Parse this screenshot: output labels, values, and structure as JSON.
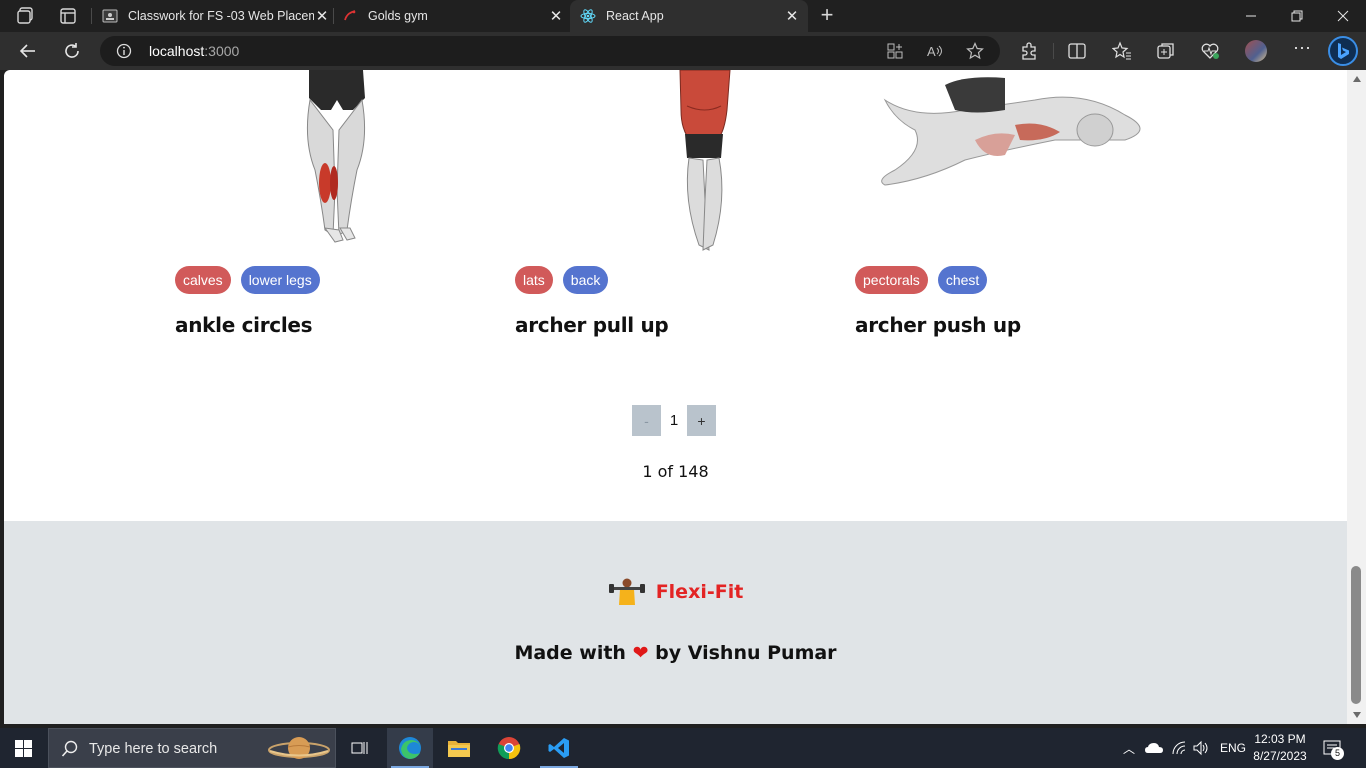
{
  "browser": {
    "tabs": [
      {
        "title": "Classwork for FS -03 Web Placem",
        "active": false
      },
      {
        "title": "Golds gym",
        "active": false
      },
      {
        "title": "React App",
        "active": true
      }
    ],
    "url_host": "localhost",
    "url_port": ":3000"
  },
  "exercises": [
    {
      "name": "ankle circles",
      "target": "calves",
      "body_part": "lower legs"
    },
    {
      "name": "archer pull up",
      "target": "lats",
      "body_part": "back"
    },
    {
      "name": "archer push up",
      "target": "pectorals",
      "body_part": "chest"
    }
  ],
  "pagination": {
    "prev": "-",
    "current": "1",
    "next": "+",
    "summary": "1 of 148"
  },
  "footer": {
    "brand": "Flexi-Fit",
    "made_prefix": "Made with",
    "heart": "❤",
    "made_suffix": "by Vishnu Pumar"
  },
  "taskbar": {
    "search_placeholder": "Type here to search",
    "lang": "ENG",
    "time": "12:03 PM",
    "date": "8/27/2023",
    "notifications": "5"
  },
  "colors": {
    "target_tag": "#d15a5a",
    "bodypart_tag": "#5574cf",
    "brand": "#e32424"
  }
}
